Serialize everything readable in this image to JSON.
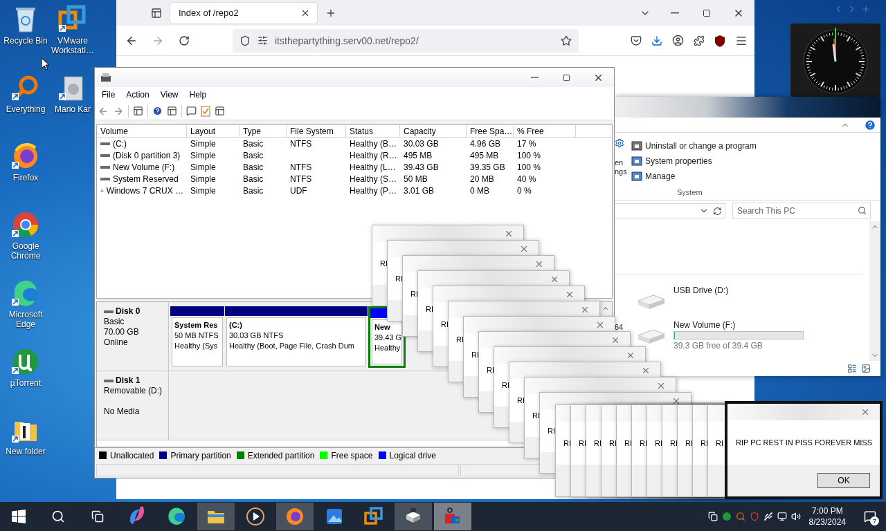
{
  "desktop_icons": [
    {
      "label": "Recycle Bin",
      "kind": "bin"
    },
    {
      "label": "Everything",
      "kind": "everything"
    },
    {
      "label": "Firefox",
      "kind": "firefox"
    },
    {
      "label": "Google Chrome",
      "kind": "chrome"
    },
    {
      "label": "Microsoft Edge",
      "kind": "edge"
    },
    {
      "label": "µTorrent",
      "kind": "utorrent"
    },
    {
      "label": "New folder",
      "kind": "folder"
    },
    {
      "label": "VMware Workstati…",
      "kind": "vmware"
    },
    {
      "label": "Mario Kar",
      "kind": "mario"
    }
  ],
  "browser": {
    "tab": {
      "title": "Index of /repo2"
    },
    "url": "itsthepartything.serv00.net/repo2/"
  },
  "explorer": {
    "ribbon_fragments": [
      "en",
      "ngs"
    ],
    "ribbon_items": [
      "Uninstall or change a program",
      "System properties",
      "Manage"
    ],
    "group": "System",
    "search": {
      "placeholder": "Search This PC"
    },
    "fragment": "64",
    "drives": [
      {
        "name": "USB Drive (D:)"
      },
      {
        "name": "New Volume (F:)",
        "level": 0.003,
        "free": "39.3 GB free of 39.4 GB"
      }
    ]
  },
  "disk_management": {
    "menu": [
      "File",
      "Action",
      "View",
      "Help"
    ],
    "columns": [
      "Volume",
      "Layout",
      "Type",
      "File System",
      "Status",
      "Capacity",
      "Free Spa…",
      "% Free"
    ],
    "rows": [
      {
        "kind": "disk",
        "cells": [
          "(C:)",
          "Simple",
          "Basic",
          "NTFS",
          "Healthy (B…",
          "30.03 GB",
          "4.96 GB",
          "17 %"
        ]
      },
      {
        "kind": "disk",
        "cells": [
          "(Disk 0 partition 3)",
          "Simple",
          "Basic",
          "",
          "Healthy (R…",
          "495 MB",
          "495 MB",
          "100 %"
        ]
      },
      {
        "kind": "disk",
        "cells": [
          "New Volume (F:)",
          "Simple",
          "Basic",
          "NTFS",
          "Healthy (L…",
          "39.43 GB",
          "39.35 GB",
          "100 %"
        ]
      },
      {
        "kind": "disk",
        "cells": [
          "System Reserved",
          "Simple",
          "Basic",
          "NTFS",
          "Healthy (S…",
          "50 MB",
          "20 MB",
          "40 %"
        ]
      },
      {
        "kind": "cdrom",
        "cells": [
          "Windows 7 CRUX …",
          "Simple",
          "Basic",
          "UDF",
          "Healthy (P…",
          "3.01 GB",
          "0 MB",
          "0 %"
        ]
      }
    ],
    "disks": [
      {
        "name": "Disk 0",
        "type": "Basic",
        "size": "70.00 GB",
        "state": "Online",
        "partitions": [
          {
            "kind": "primary",
            "name": "System Res",
            "size": "50 MB NTFS",
            "status": "Healthy (Sys"
          },
          {
            "kind": "primary",
            "name": "(C:)",
            "size": "30.03 GB NTFS",
            "status": "Healthy (Boot, Page File, Crash Dum"
          },
          {
            "kind": "logical",
            "name": "New",
            "size": "39.43 G",
            "status": "Healthy"
          }
        ]
      },
      {
        "name": "Disk 1",
        "type": "Removable (D:)",
        "state": "No Media"
      }
    ],
    "legend": [
      {
        "label": "Unallocated",
        "color": "#000000"
      },
      {
        "label": "Primary partition",
        "color": "#000080"
      },
      {
        "label": "Extended partition",
        "color": "#008000"
      },
      {
        "label": "Free space",
        "color": "#00ff00"
      },
      {
        "label": "Logical drive",
        "color": "#0000ff"
      }
    ]
  },
  "popups": [
    {
      "text": "RI"
    },
    {
      "text": "RI"
    },
    {
      "text": "RI"
    },
    {
      "text": "RI"
    },
    {
      "text": "RI"
    },
    {
      "text": "RI"
    },
    {
      "text": "RI"
    },
    {
      "text": "RI"
    },
    {
      "text": "RI"
    },
    {
      "text": "RI"
    },
    {
      "text": "RI"
    },
    {
      "text": "RI"
    },
    {
      "text": "RI"
    },
    {
      "text": "RI"
    },
    {
      "text": "RI"
    },
    {
      "text": "RI"
    },
    {
      "text": "RI"
    },
    {
      "text": "RI"
    },
    {
      "text": "RI"
    },
    {
      "text": "RI"
    },
    {
      "text": "RI"
    },
    {
      "text": "RI"
    },
    {
      "text": "RI"
    }
  ],
  "dialog": {
    "message": "RIP PC REST IN PISS FOREVER MISS",
    "button": "OK"
  },
  "taskbar": {
    "apps": [
      {
        "kind": "copilot",
        "active": false,
        "focused": false
      },
      {
        "kind": "edge",
        "active": false,
        "focused": false
      },
      {
        "kind": "explorer",
        "active": true,
        "focused": false
      },
      {
        "kind": "player",
        "active": false,
        "focused": false
      },
      {
        "kind": "firefox",
        "active": true,
        "focused": false
      },
      {
        "kind": "photos",
        "active": false,
        "focused": false
      },
      {
        "kind": "vmware",
        "active": false,
        "focused": false
      },
      {
        "kind": "drive",
        "active": true,
        "focused": false
      },
      {
        "kind": "shapes",
        "active": true,
        "focused": true
      }
    ],
    "time": "7:00 PM",
    "date": "8/23/2024",
    "notifications": "7"
  }
}
